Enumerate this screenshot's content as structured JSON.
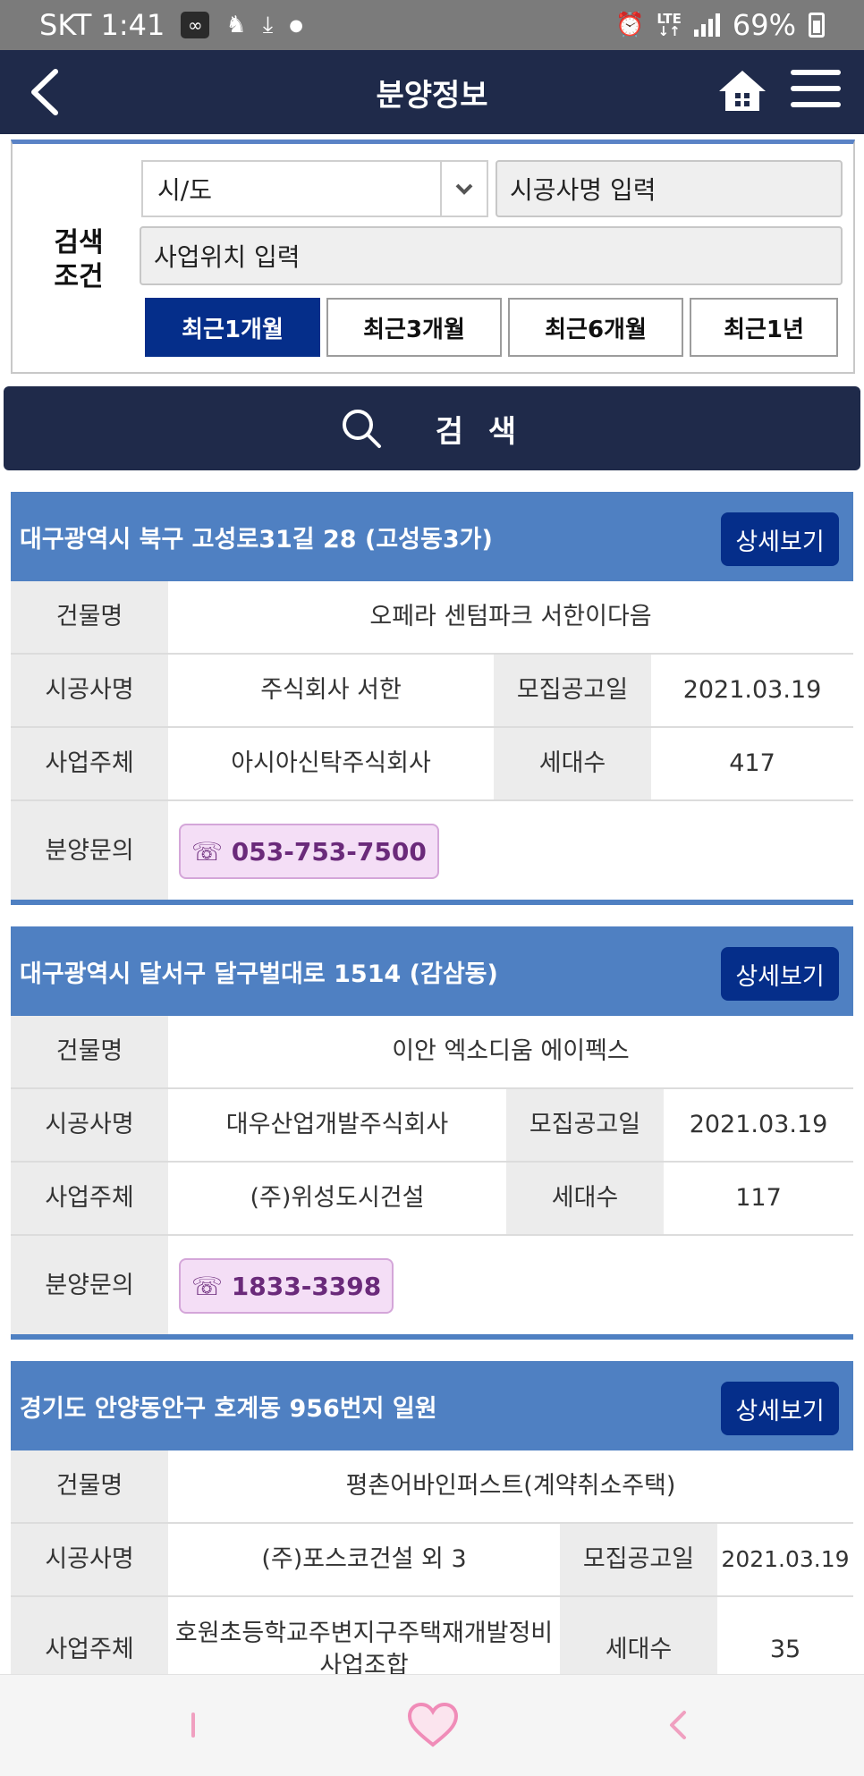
{
  "status_bar": {
    "carrier_time": "SKT 1:41",
    "infinity_glyph": "∞",
    "lte": "LTE",
    "lte_arrows": "↓↑",
    "battery": "69%"
  },
  "header": {
    "title": "분양정보"
  },
  "search": {
    "label_line1": "검색",
    "label_line2": "조건",
    "region_select": "시/도",
    "builder_placeholder": "시공사명 입력",
    "location_placeholder": "사업위치 입력",
    "periods": [
      "최근1개월",
      "최근3개월",
      "최근6개월",
      "최근1년"
    ],
    "active_period": 0,
    "button_label": "검 색"
  },
  "labels": {
    "building": "건물명",
    "builder": "시공사명",
    "notice_date": "모집공고일",
    "developer": "사업주체",
    "households": "세대수",
    "inquiry": "분양문의",
    "detail": "상세보기"
  },
  "listings": [
    {
      "address": "대구광역시 북구 고성로31길 28 (고성동3가)",
      "building": "오페라 센텀파크 서한이다음",
      "builder": "주식회사 서한",
      "notice_date": "2021.03.19",
      "developer": "아시아신탁주식회사",
      "households": "417",
      "phone": "☏ 053-753-7500"
    },
    {
      "address": "대구광역시 달서구 달구벌대로 1514 (감삼동)",
      "building": "이안 엑소디움 에이펙스",
      "builder": "대우산업개발주식회사",
      "notice_date": "2021.03.19",
      "developer": "(주)위성도시건설",
      "households": "117",
      "phone": "☏ 1833-3398"
    },
    {
      "address": "경기도 안양동안구 호계동 956번지 일원",
      "building": "평촌어바인퍼스트(계약취소주택)",
      "builder": "(주)포스코건설 외 3",
      "notice_date": "2021.03.19",
      "developer": "호원초등학교주변지구주택재개발정비사업조합",
      "households": "35"
    }
  ],
  "colors": {
    "header_bg": "#1f2a4a",
    "card_header": "#4f80c2",
    "accent_blue": "#052e8a",
    "phone_text": "#6a2a7a",
    "phone_bg": "#f4def6"
  },
  "bottom_nav": {
    "icons": [
      "bar-icon",
      "heart-icon",
      "back-arrow-icon"
    ]
  }
}
